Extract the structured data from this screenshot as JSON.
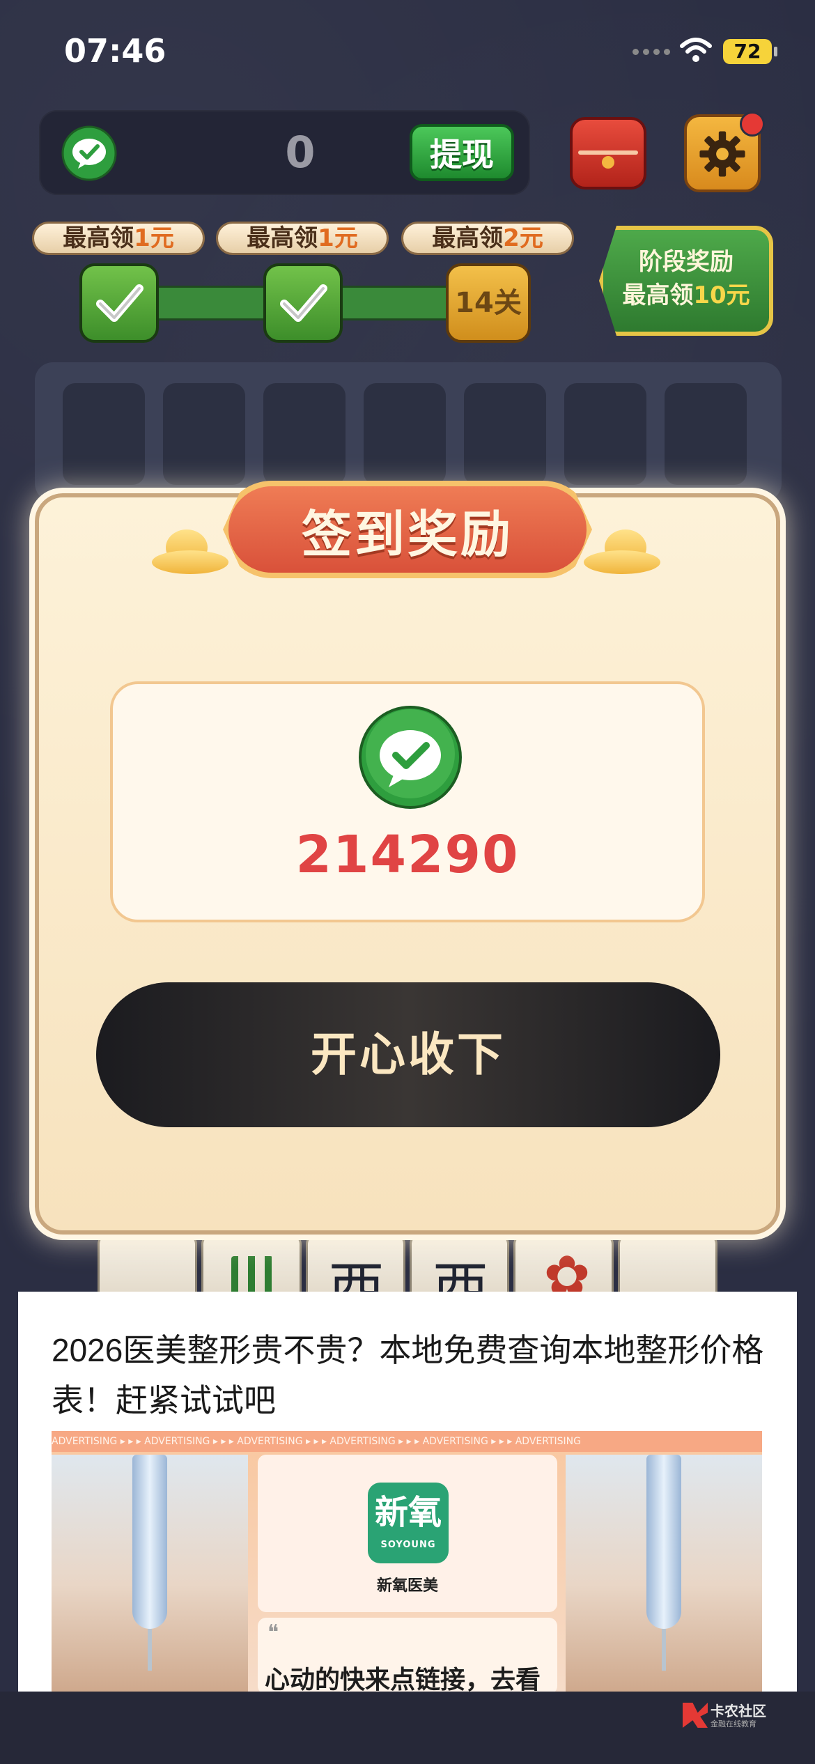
{
  "status_bar": {
    "time": "07:46",
    "battery": "72"
  },
  "balance": {
    "value": "0",
    "withdraw_label": "提现"
  },
  "stages": [
    {
      "label_prefix": "最高领",
      "amount": "1元"
    },
    {
      "label_prefix": "最高领",
      "amount": "1元"
    },
    {
      "label_prefix": "最高领",
      "amount": "2元"
    }
  ],
  "level_label": "14关",
  "stage_reward": {
    "line1": "阶段奖励",
    "line2_prefix": "最高领",
    "line2_amount": "10元"
  },
  "dialog": {
    "title": "签到奖励",
    "reward_amount": "214290",
    "collect_label": "开心收下"
  },
  "ad": {
    "headline": "2026医美整形贵不贵？本地免费查询本地整形价格表！赶紧试试吧",
    "strip_text": "ADVERTISING  ▸ ▸ ▸  ADVERTISING  ▸ ▸ ▸  ADVERTISING  ▸ ▸ ▸  ADVERTISING  ▸ ▸ ▸  ADVERTISING  ▸ ▸ ▸  ADVERTISING",
    "brand_logo_text": "新氧",
    "brand_logo_en": "SOYOUNG",
    "brand_name": "新氧医美",
    "slogan": "心动的快来点链接，去看"
  },
  "watermark": {
    "title": "卡农社区",
    "subtitle": "金融在线教育"
  },
  "colors": {
    "accent_green": "#2e9e3e",
    "reward_red": "#e04444",
    "title_orange": "#d9513a"
  }
}
